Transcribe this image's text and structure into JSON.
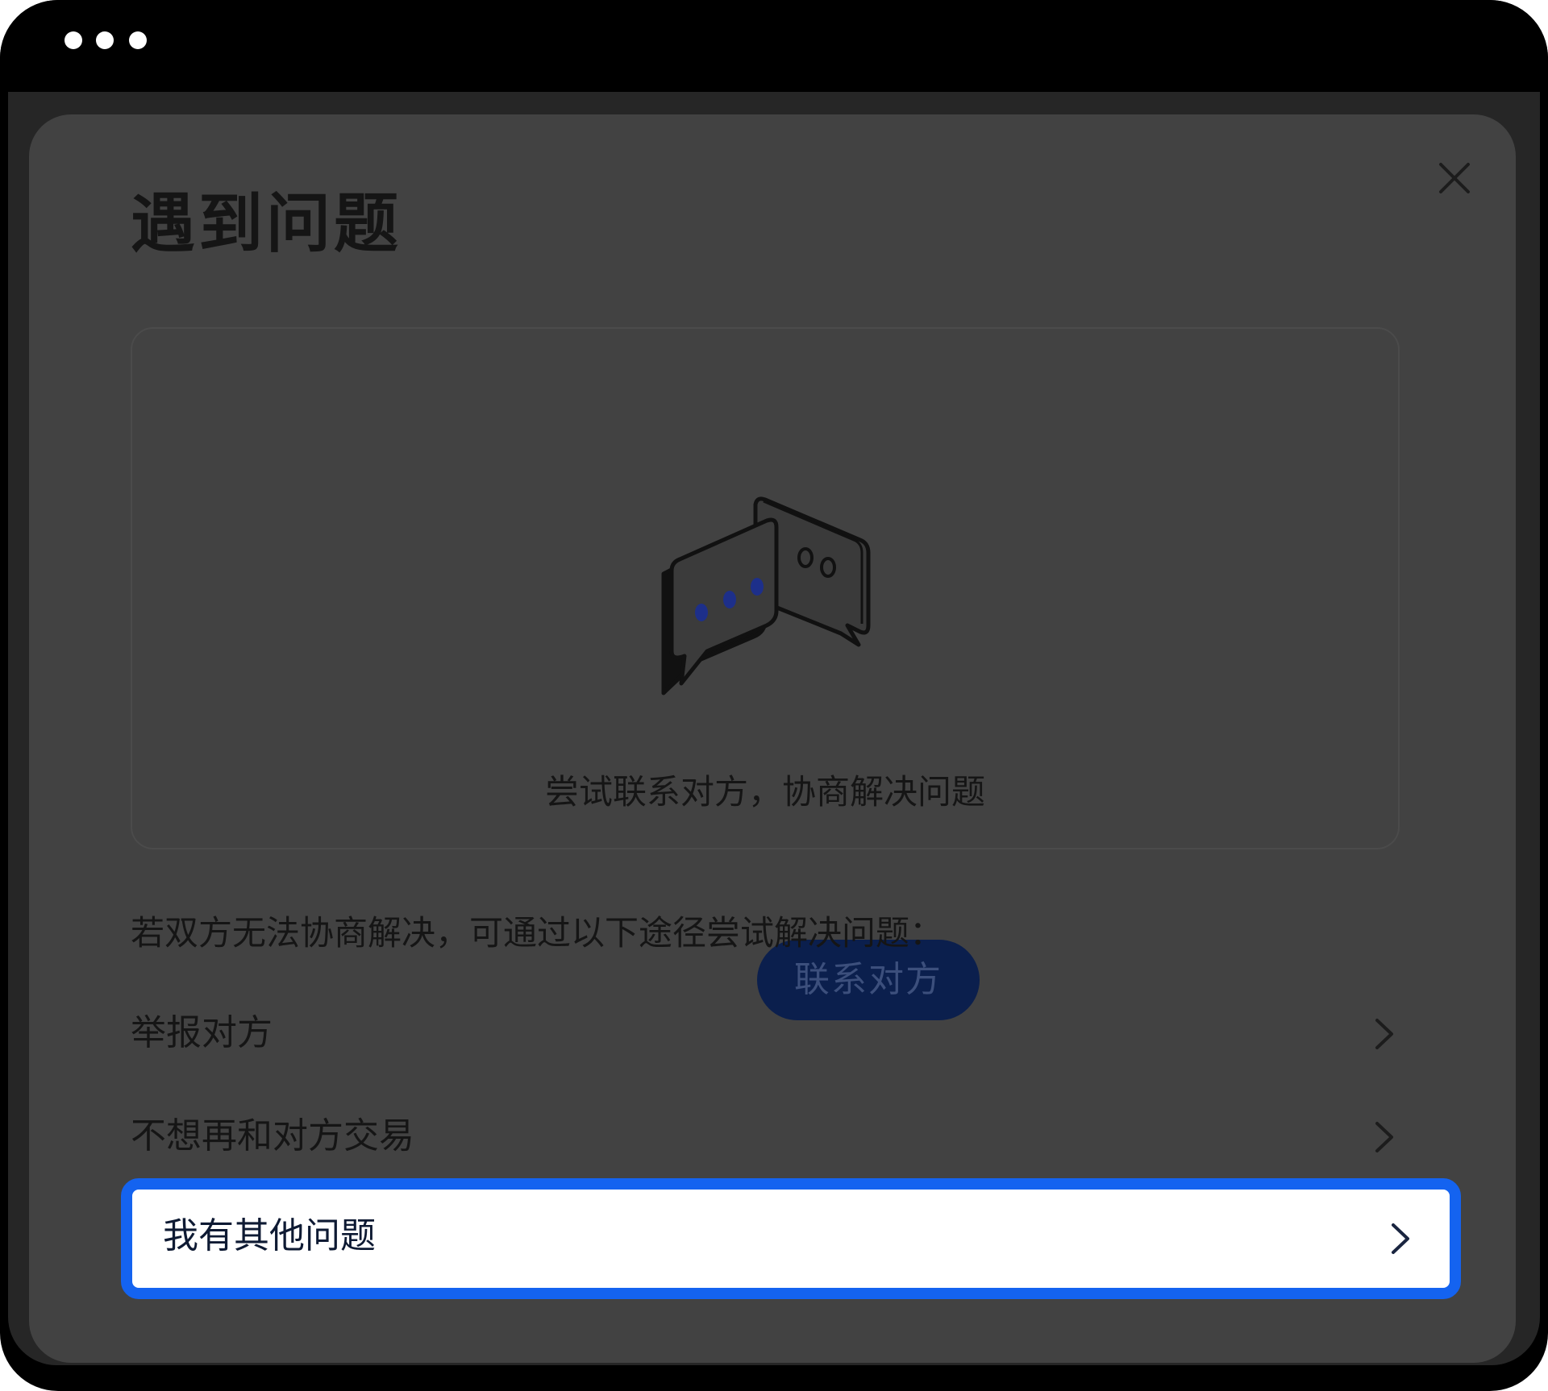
{
  "window": {
    "controls": [
      "dot",
      "dot",
      "dot"
    ]
  },
  "dialog": {
    "title": "遇到问题",
    "close_icon": "close-icon",
    "contact_card": {
      "illustration": "chat-bubbles-icon",
      "message": "尝试联系对方，协商解决问题",
      "button_label": "联系对方"
    },
    "instructions": "若双方无法协商解决，可通过以下途径尝试解决问题：",
    "options": [
      {
        "label": "举报对方",
        "icon": "chevron-right-icon",
        "selected": false
      },
      {
        "label": "不想再和对方交易",
        "icon": "chevron-right-icon",
        "selected": false
      },
      {
        "label": "我有其他问题",
        "icon": "chevron-right-icon",
        "selected": true
      }
    ]
  },
  "colors": {
    "overlay": "#424242",
    "primary_button": "#0b1f4d",
    "highlight_border": "#1463f0",
    "selected_row_bg": "#ffffff",
    "illustration_accent": "#1d2f8a"
  }
}
